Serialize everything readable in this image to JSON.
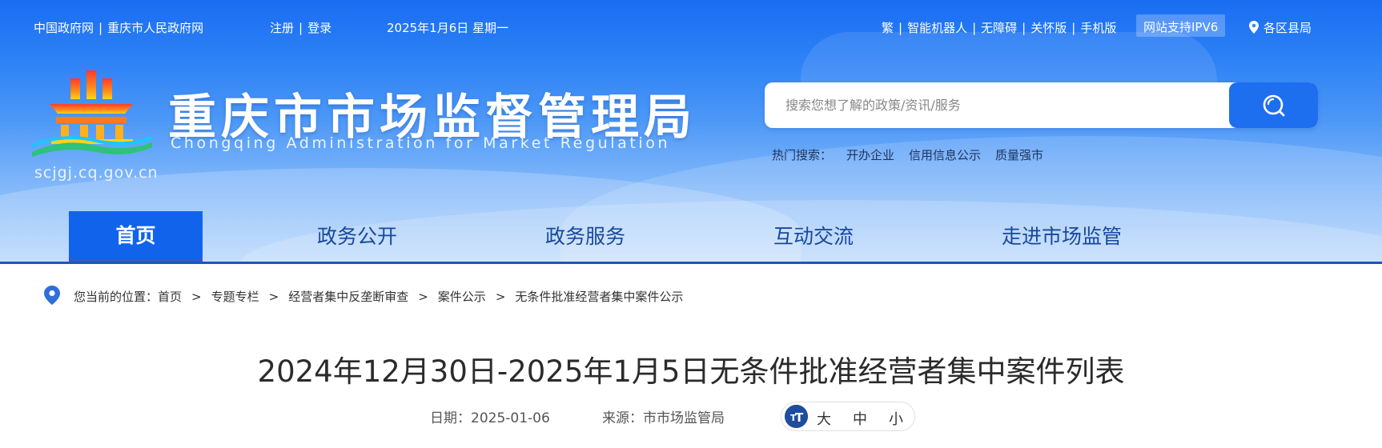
{
  "topbar": {
    "gov_link": "中国政府网",
    "city_link": "重庆市人民政府网",
    "register": "注册",
    "login": "登录",
    "date": "2025年1月6日 星期一",
    "traditional": "繁",
    "robot": "智能机器人",
    "accessible": "无障碍",
    "care": "关怀版",
    "mobile": "手机版",
    "ipv6": "网站支持IPV6",
    "region": "各区县局"
  },
  "logo": {
    "name_cn": "重庆市市场监督管理局",
    "name_en": "Chongqing Administration for Market Regulation",
    "domain": "scjgj.cq.gov.cn"
  },
  "search": {
    "placeholder": "搜索您想了解的政策/资讯/服务",
    "hot_label": "热门搜索：",
    "hot_items": [
      "开办企业",
      "信用信息公示",
      "质量强市"
    ]
  },
  "nav": {
    "items": [
      "首页",
      "政务公开",
      "政务服务",
      "互动交流",
      "走进市场监管"
    ],
    "active_index": 0
  },
  "breadcrumb": {
    "prefix": "您当前的位置：",
    "items": [
      "首页",
      "专题专栏",
      "经营者集中反垄断审查",
      "案件公示",
      "无条件批准经营者集中案件公示"
    ],
    "separator": ">"
  },
  "article": {
    "title": "2024年12月30日-2025年1月5日无条件批准经营者集中案件列表",
    "date_label": "日期：",
    "date": "2025-01-06",
    "source_label": "来源：",
    "source": "市市场监管局",
    "font_sizes": [
      "大",
      "中",
      "小"
    ]
  },
  "colors": {
    "brand_blue": "#1163ec",
    "active_underline": "#e2231a",
    "nav_text": "#18489c"
  }
}
